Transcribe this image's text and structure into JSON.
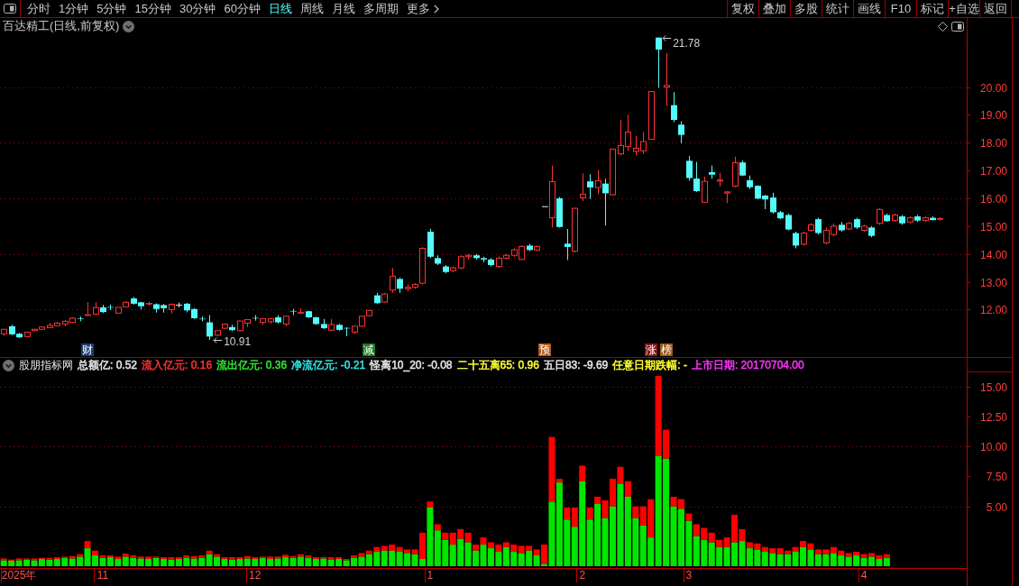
{
  "toolbar": {
    "tabs": [
      {
        "label": "分时",
        "kind": "tab",
        "selected": false
      },
      {
        "label": "1分钟",
        "kind": "tab",
        "selected": false
      },
      {
        "label": "5分钟",
        "kind": "tab",
        "selected": false
      },
      {
        "label": "15分钟",
        "kind": "tab",
        "selected": false
      },
      {
        "label": "30分钟",
        "kind": "tab",
        "selected": false
      },
      {
        "label": "60分钟",
        "kind": "tab",
        "selected": false
      },
      {
        "label": "日线",
        "kind": "tab",
        "selected": true
      },
      {
        "label": "周线",
        "kind": "tab",
        "selected": false
      },
      {
        "label": "月线",
        "kind": "tab",
        "selected": false
      },
      {
        "label": "多周期",
        "kind": "tab",
        "selected": false
      },
      {
        "label": "更多",
        "kind": "menu",
        "selected": false
      }
    ],
    "buttons": [
      "复权",
      "叠加",
      "多股",
      "统计",
      "画线",
      "F10",
      "标记",
      "+自选",
      "返回"
    ]
  },
  "price_pane": {
    "title": "百达精工(日线,前复权)",
    "markers": [
      {
        "color": "#1e3c78"
      },
      {
        "color": "#1e7a1e"
      },
      {
        "color": "#b4561a"
      },
      {
        "color": "#8c1414"
      },
      {
        "color": "#a0581e"
      }
    ],
    "chart_data": {
      "type": "candlestick",
      "ylim": [
        10.78,
        21.9
      ],
      "yticks": [
        {
          "value": 12,
          "label": "12.00"
        },
        {
          "value": 13,
          "label": "13.00"
        },
        {
          "value": 14,
          "label": "14.00"
        },
        {
          "value": 15,
          "label": "15.00"
        },
        {
          "value": 16,
          "label": "16.00"
        },
        {
          "value": 17,
          "label": "17.00"
        },
        {
          "value": 18,
          "label": "18.00"
        },
        {
          "value": 19,
          "label": "19.00"
        },
        {
          "value": 20,
          "label": "20.00"
        }
      ],
      "grid": true,
      "annotations": [
        "21.78",
        "10.91"
      ],
      "categories": [
        null,
        null,
        null,
        null,
        null,
        null,
        null,
        null,
        null,
        null,
        null,
        "财",
        null,
        null,
        null,
        null,
        null,
        null,
        null,
        null,
        null,
        null,
        null,
        null,
        null,
        null,
        null,
        null,
        null,
        null,
        null,
        null,
        null,
        null,
        null,
        null,
        null,
        null,
        null,
        null,
        null,
        null,
        null,
        null,
        null,
        null,
        null,
        null,
        "减",
        null,
        null,
        null,
        null,
        null,
        null,
        null,
        null,
        null,
        null,
        null,
        null,
        null,
        null,
        null,
        null,
        null,
        null,
        null,
        null,
        null,
        null,
        "预",
        null,
        null,
        null,
        null,
        null,
        null,
        null,
        null,
        null,
        null,
        null,
        null,
        null,
        "涨",
        null,
        "榜",
        null,
        null,
        null,
        null,
        null,
        null,
        null,
        null,
        null,
        null,
        null,
        null,
        null,
        null,
        null,
        null,
        null,
        null,
        null,
        null,
        null,
        null,
        null,
        null,
        null,
        null,
        null,
        null,
        null,
        null,
        null,
        null,
        null,
        null,
        null,
        null,
        null,
        null,
        null
      ],
      "ohlc": [
        [
          11.13,
          11.29,
          11.05,
          11.29
        ],
        [
          11.4,
          11.45,
          11.08,
          11.11
        ],
        [
          11.13,
          11.16,
          10.98,
          11.0
        ],
        [
          11.03,
          11.19,
          11.0,
          11.19
        ],
        [
          11.24,
          11.3,
          11.22,
          11.29
        ],
        [
          11.29,
          11.4,
          11.26,
          11.37
        ],
        [
          11.35,
          11.52,
          11.33,
          11.43
        ],
        [
          11.42,
          11.55,
          11.4,
          11.51
        ],
        [
          11.48,
          11.62,
          11.4,
          11.58
        ],
        [
          11.54,
          11.72,
          11.52,
          11.69
        ],
        [
          11.68,
          11.75,
          11.58,
          11.66
        ],
        [
          11.8,
          12.27,
          11.8,
          11.81
        ],
        [
          11.83,
          12.27,
          11.8,
          12.07
        ],
        [
          12.08,
          12.17,
          11.88,
          11.91
        ],
        [
          12.09,
          12.18,
          11.98,
          12.07
        ],
        [
          11.87,
          12.08,
          11.85,
          12.08
        ],
        [
          12.1,
          12.3,
          12.08,
          12.26
        ],
        [
          12.4,
          12.45,
          12.18,
          12.21
        ],
        [
          12.26,
          12.28,
          12.0,
          12.12
        ],
        [
          12.2,
          12.28,
          12.15,
          12.22
        ],
        [
          12.19,
          12.22,
          11.89,
          12.02
        ],
        [
          12.16,
          12.2,
          11.89,
          12.05
        ],
        [
          12.0,
          12.22,
          11.85,
          12.19
        ],
        [
          12.16,
          12.25,
          12.08,
          12.16
        ],
        [
          12.21,
          12.24,
          11.9,
          11.97
        ],
        [
          12.02,
          12.05,
          11.66,
          11.69
        ],
        [
          11.67,
          11.75,
          11.58,
          11.66
        ],
        [
          11.54,
          11.8,
          10.91,
          11.03
        ],
        [
          11.08,
          11.24,
          11.03,
          11.24
        ],
        [
          11.33,
          11.48,
          11.3,
          11.48
        ],
        [
          11.37,
          11.45,
          11.22,
          11.26
        ],
        [
          11.24,
          11.59,
          11.22,
          11.59
        ],
        [
          11.51,
          11.64,
          11.37,
          11.64
        ],
        [
          11.7,
          11.8,
          11.6,
          11.68
        ],
        [
          11.54,
          11.67,
          11.45,
          11.67
        ],
        [
          11.56,
          11.7,
          11.5,
          11.67
        ],
        [
          11.72,
          11.8,
          11.5,
          11.54
        ],
        [
          11.48,
          11.76,
          11.4,
          11.76
        ],
        [
          11.95,
          12.02,
          11.8,
          11.93
        ],
        [
          11.88,
          12.05,
          11.85,
          11.89
        ],
        [
          11.94,
          11.96,
          11.7,
          11.72
        ],
        [
          11.72,
          11.74,
          11.45,
          11.48
        ],
        [
          11.48,
          11.66,
          11.3,
          11.33
        ],
        [
          11.26,
          11.66,
          11.22,
          11.46
        ],
        [
          11.45,
          11.48,
          11.24,
          11.27
        ],
        [
          11.34,
          11.36,
          11.04,
          11.32
        ],
        [
          11.19,
          11.4,
          11.12,
          11.4
        ],
        [
          11.4,
          11.76,
          11.38,
          11.76
        ],
        [
          11.78,
          11.97,
          11.75,
          11.97
        ],
        [
          12.51,
          12.6,
          12.2,
          12.23
        ],
        [
          12.27,
          12.6,
          12.25,
          12.56
        ],
        [
          12.7,
          13.5,
          12.6,
          13.2
        ],
        [
          13.1,
          13.15,
          12.6,
          12.75
        ],
        [
          12.75,
          12.9,
          12.65,
          12.8
        ],
        [
          12.8,
          12.95,
          12.75,
          12.9
        ],
        [
          12.95,
          14.25,
          12.9,
          14.2
        ],
        [
          14.8,
          14.9,
          13.85,
          13.9
        ],
        [
          13.85,
          13.95,
          13.6,
          13.65
        ],
        [
          13.55,
          13.6,
          13.3,
          13.35
        ],
        [
          13.4,
          13.55,
          13.35,
          13.5
        ],
        [
          13.5,
          13.95,
          13.45,
          13.9
        ],
        [
          13.9,
          14.0,
          13.8,
          13.95
        ],
        [
          13.95,
          14.0,
          13.8,
          13.85
        ],
        [
          13.85,
          13.9,
          13.7,
          13.8
        ],
        [
          13.8,
          13.85,
          13.55,
          13.6
        ],
        [
          13.55,
          13.9,
          13.5,
          13.85
        ],
        [
          13.85,
          14.0,
          13.8,
          13.95
        ],
        [
          13.95,
          14.2,
          13.9,
          14.15
        ],
        [
          13.8,
          14.3,
          13.78,
          14.27
        ],
        [
          14.3,
          14.36,
          14.1,
          14.14
        ],
        [
          14.14,
          14.3,
          14.1,
          14.27
        ],
        [
          15.7,
          15.7,
          15.7,
          15.7
        ],
        [
          15.3,
          17.18,
          14.95,
          16.6
        ],
        [
          16.0,
          16.05,
          14.95,
          14.97
        ],
        [
          14.37,
          14.9,
          13.78,
          14.25
        ],
        [
          14.1,
          15.66,
          14.05,
          15.64
        ],
        [
          16.02,
          16.9,
          15.9,
          16.15
        ],
        [
          16.61,
          16.87,
          15.98,
          16.39
        ],
        [
          16.39,
          17.02,
          16.15,
          16.63
        ],
        [
          16.53,
          16.7,
          15.02,
          16.18
        ],
        [
          16.13,
          17.77,
          16.1,
          17.77
        ],
        [
          17.6,
          18.81,
          17.55,
          17.9
        ],
        [
          17.86,
          19.0,
          17.71,
          18.38
        ],
        [
          17.69,
          18.25,
          17.55,
          17.8
        ],
        [
          17.71,
          18.38,
          17.6,
          18.04
        ],
        [
          18.12,
          19.84,
          18.1,
          19.84
        ],
        [
          21.78,
          21.78,
          19.98,
          21.35
        ],
        [
          20.0,
          21.22,
          19.32,
          20.06
        ],
        [
          19.35,
          19.82,
          18.74,
          18.82
        ],
        [
          18.65,
          18.77,
          17.98,
          18.28
        ],
        [
          17.35,
          17.52,
          16.63,
          16.73
        ],
        [
          16.71,
          17.31,
          16.23,
          16.26
        ],
        [
          15.86,
          16.78,
          15.84,
          16.61
        ],
        [
          16.94,
          17.18,
          16.7,
          16.85
        ],
        [
          16.62,
          16.92,
          16.42,
          16.66
        ],
        [
          16.19,
          16.26,
          15.83,
          16.23
        ],
        [
          16.44,
          17.5,
          16.4,
          17.28
        ],
        [
          17.29,
          17.36,
          16.8,
          16.82
        ],
        [
          16.65,
          16.82,
          16.33,
          16.4
        ],
        [
          16.45,
          16.47,
          15.97,
          15.99
        ],
        [
          16.1,
          16.12,
          15.61,
          15.96
        ],
        [
          16.03,
          16.2,
          15.45,
          15.5
        ],
        [
          15.5,
          15.55,
          15.25,
          15.28
        ],
        [
          15.4,
          15.45,
          14.85,
          14.88
        ],
        [
          14.75,
          14.8,
          14.2,
          14.3
        ],
        [
          14.35,
          14.8,
          14.3,
          14.75
        ],
        [
          14.85,
          15.1,
          14.8,
          15.05
        ],
        [
          15.25,
          15.3,
          14.7,
          14.75
        ],
        [
          14.4,
          14.95,
          14.35,
          14.85
        ],
        [
          14.7,
          15.1,
          14.65,
          15.0
        ],
        [
          15.05,
          15.15,
          14.8,
          14.85
        ],
        [
          14.9,
          15.15,
          14.85,
          15.1
        ],
        [
          15.25,
          15.3,
          14.9,
          14.95
        ],
        [
          14.85,
          15.05,
          14.8,
          15.0
        ],
        [
          14.95,
          15.0,
          14.6,
          14.65
        ],
        [
          15.1,
          15.65,
          15.05,
          15.6
        ],
        [
          15.4,
          15.45,
          15.15,
          15.18
        ],
        [
          15.2,
          15.45,
          15.15,
          15.4
        ],
        [
          15.35,
          15.4,
          15.05,
          15.1
        ],
        [
          15.15,
          15.35,
          15.1,
          15.3
        ],
        [
          15.35,
          15.4,
          15.15,
          15.2
        ],
        [
          15.2,
          15.35,
          15.15,
          15.3
        ],
        [
          15.3,
          15.35,
          15.2,
          15.22
        ],
        [
          15.25,
          15.32,
          15.2,
          15.27
        ],
        null,
        null,
        null
      ]
    }
  },
  "indicator_pane": {
    "title": "股朋指标网",
    "readings": [
      {
        "text": "总额亿: 0.52",
        "color": "#e6e6e6"
      },
      {
        "text": "流入亿元: 0.16",
        "color": "#ff3232"
      },
      {
        "text": "流出亿元: 0.36",
        "color": "#32e632"
      },
      {
        "text": "净流亿元: -0.21",
        "color": "#32e6e6"
      },
      {
        "text": "怪离10_20: -0.08",
        "color": "#e6e6e6"
      },
      {
        "text": "二十五离65: 0.96",
        "color": "#ffff32"
      },
      {
        "text": "五日83: -9.69",
        "color": "#e6e6e6"
      },
      {
        "text": "任意日期跌幅: -",
        "color": "#ffff32"
      },
      {
        "text": "上市日期: 20170704.00",
        "color": "#ff32ff"
      }
    ],
    "chart_data": {
      "type": "bar",
      "stacked": true,
      "ylim": [
        0,
        16.2
      ],
      "yticks": [
        {
          "value": 5,
          "label": "5.00"
        },
        {
          "value": 7.5,
          "label": "7.50"
        },
        {
          "value": 10,
          "label": "10.00"
        },
        {
          "value": 12.5,
          "label": "12.50"
        },
        {
          "value": 15,
          "label": "15.00"
        }
      ],
      "grid": true,
      "categories": [
        null,
        null,
        "2025年",
        null,
        null,
        null,
        null,
        null,
        null,
        null,
        null,
        null,
        null,
        "11",
        null,
        null,
        null,
        null,
        null,
        null,
        null,
        null,
        null,
        null,
        null,
        null,
        null,
        null,
        null,
        null,
        null,
        null,
        null,
        "12",
        null,
        null,
        null,
        null,
        null,
        null,
        null,
        null,
        null,
        null,
        null,
        null,
        null,
        null,
        null,
        null,
        null,
        null,
        null,
        null,
        null,
        null,
        "1",
        null,
        null,
        null,
        null,
        null,
        null,
        null,
        null,
        null,
        null,
        null,
        null,
        null,
        null,
        null,
        null,
        null,
        null,
        null,
        "2",
        null,
        null,
        null,
        null,
        null,
        null,
        null,
        null,
        null,
        null,
        null,
        null,
        null,
        "3",
        null,
        null,
        null,
        null,
        null,
        null,
        null,
        null,
        null,
        null,
        null,
        null,
        null,
        null,
        null,
        null,
        null,
        null,
        null,
        null,
        null,
        null,
        "4",
        null,
        null,
        null,
        null,
        null,
        null,
        null,
        null,
        null,
        null,
        null,
        null,
        null
      ],
      "series": [
        {
          "color": "#00e600",
          "values": [
            0.5,
            0.45,
            0.5,
            0.55,
            0.5,
            0.6,
            0.55,
            0.6,
            0.7,
            0.65,
            0.8,
            1.5,
            0.9,
            0.7,
            0.75,
            0.6,
            0.8,
            0.7,
            0.65,
            0.6,
            0.7,
            0.6,
            0.55,
            0.6,
            0.7,
            0.65,
            0.7,
            1.0,
            0.8,
            0.6,
            0.55,
            0.6,
            0.65,
            0.6,
            0.7,
            0.6,
            0.65,
            0.75,
            0.7,
            0.8,
            0.7,
            0.6,
            0.65,
            0.55,
            0.6,
            0.5,
            0.7,
            0.8,
            1.0,
            1.2,
            1.3,
            1.3,
            1.2,
            1.1,
            1.0,
            0.6,
            4.9,
            3.0,
            2.2,
            1.8,
            2.3,
            2.0,
            1.3,
            1.8,
            1.5,
            1.2,
            1.6,
            1.2,
            1.1,
            1.3,
            0.9,
            0.2,
            5.4,
            7.0,
            3.9,
            3.3,
            7.1,
            3.9,
            5.2,
            4.0,
            5.0,
            6.9,
            5.8,
            4.0,
            3.4,
            2.4,
            9.2,
            9.0,
            5.0,
            4.8,
            3.8,
            2.5,
            2.2,
            2.0,
            1.6,
            1.6,
            2.0,
            2.1,
            1.5,
            1.4,
            1.2,
            1.1,
            1.0,
            1.0,
            1.2,
            1.6,
            1.4,
            1.0,
            1.0,
            1.1,
            0.9,
            0.8,
            0.9,
            0.7,
            0.8,
            0.6,
            0.7,
            null,
            null,
            null,
            null,
            null,
            null,
            null,
            null,
            null,
            null
          ]
        },
        {
          "color": "#ff0000",
          "values": [
            0.15,
            0.1,
            0.15,
            0.1,
            0.15,
            0.1,
            0.15,
            0.15,
            0.1,
            0.2,
            0.2,
            0.6,
            0.4,
            0.2,
            0.15,
            0.2,
            0.25,
            0.2,
            0.15,
            0.2,
            0.1,
            0.15,
            0.2,
            0.15,
            0.2,
            0.2,
            0.2,
            0.3,
            0.2,
            0.15,
            0.2,
            0.15,
            0.2,
            0.15,
            0.1,
            0.2,
            0.15,
            0.2,
            0.15,
            0.2,
            0.2,
            0.15,
            0.1,
            0.2,
            0.15,
            0.1,
            0.2,
            0.3,
            0.3,
            0.4,
            0.4,
            0.5,
            0.4,
            0.3,
            0.4,
            2.2,
            0.5,
            0.5,
            0.6,
            1.0,
            0.8,
            0.8,
            0.5,
            0.6,
            0.5,
            0.6,
            0.4,
            0.6,
            0.6,
            0.4,
            0.5,
            1.6,
            5.4,
            0.3,
            1.0,
            1.6,
            1.3,
            1.0,
            0.6,
            1.5,
            2.3,
            1.4,
            1.3,
            1.0,
            1.6,
            3.2,
            6.7,
            2.4,
            0.8,
            0.8,
            0.6,
            1.0,
            1.0,
            0.8,
            0.6,
            0.8,
            2.3,
            1.0,
            0.5,
            0.5,
            0.4,
            0.4,
            0.5,
            0.3,
            0.4,
            0.5,
            0.5,
            0.4,
            0.4,
            0.5,
            0.4,
            0.3,
            0.3,
            0.3,
            0.3,
            0.3,
            0.3,
            null,
            null,
            null,
            null,
            null,
            null,
            null,
            null,
            null,
            null
          ]
        }
      ]
    }
  }
}
